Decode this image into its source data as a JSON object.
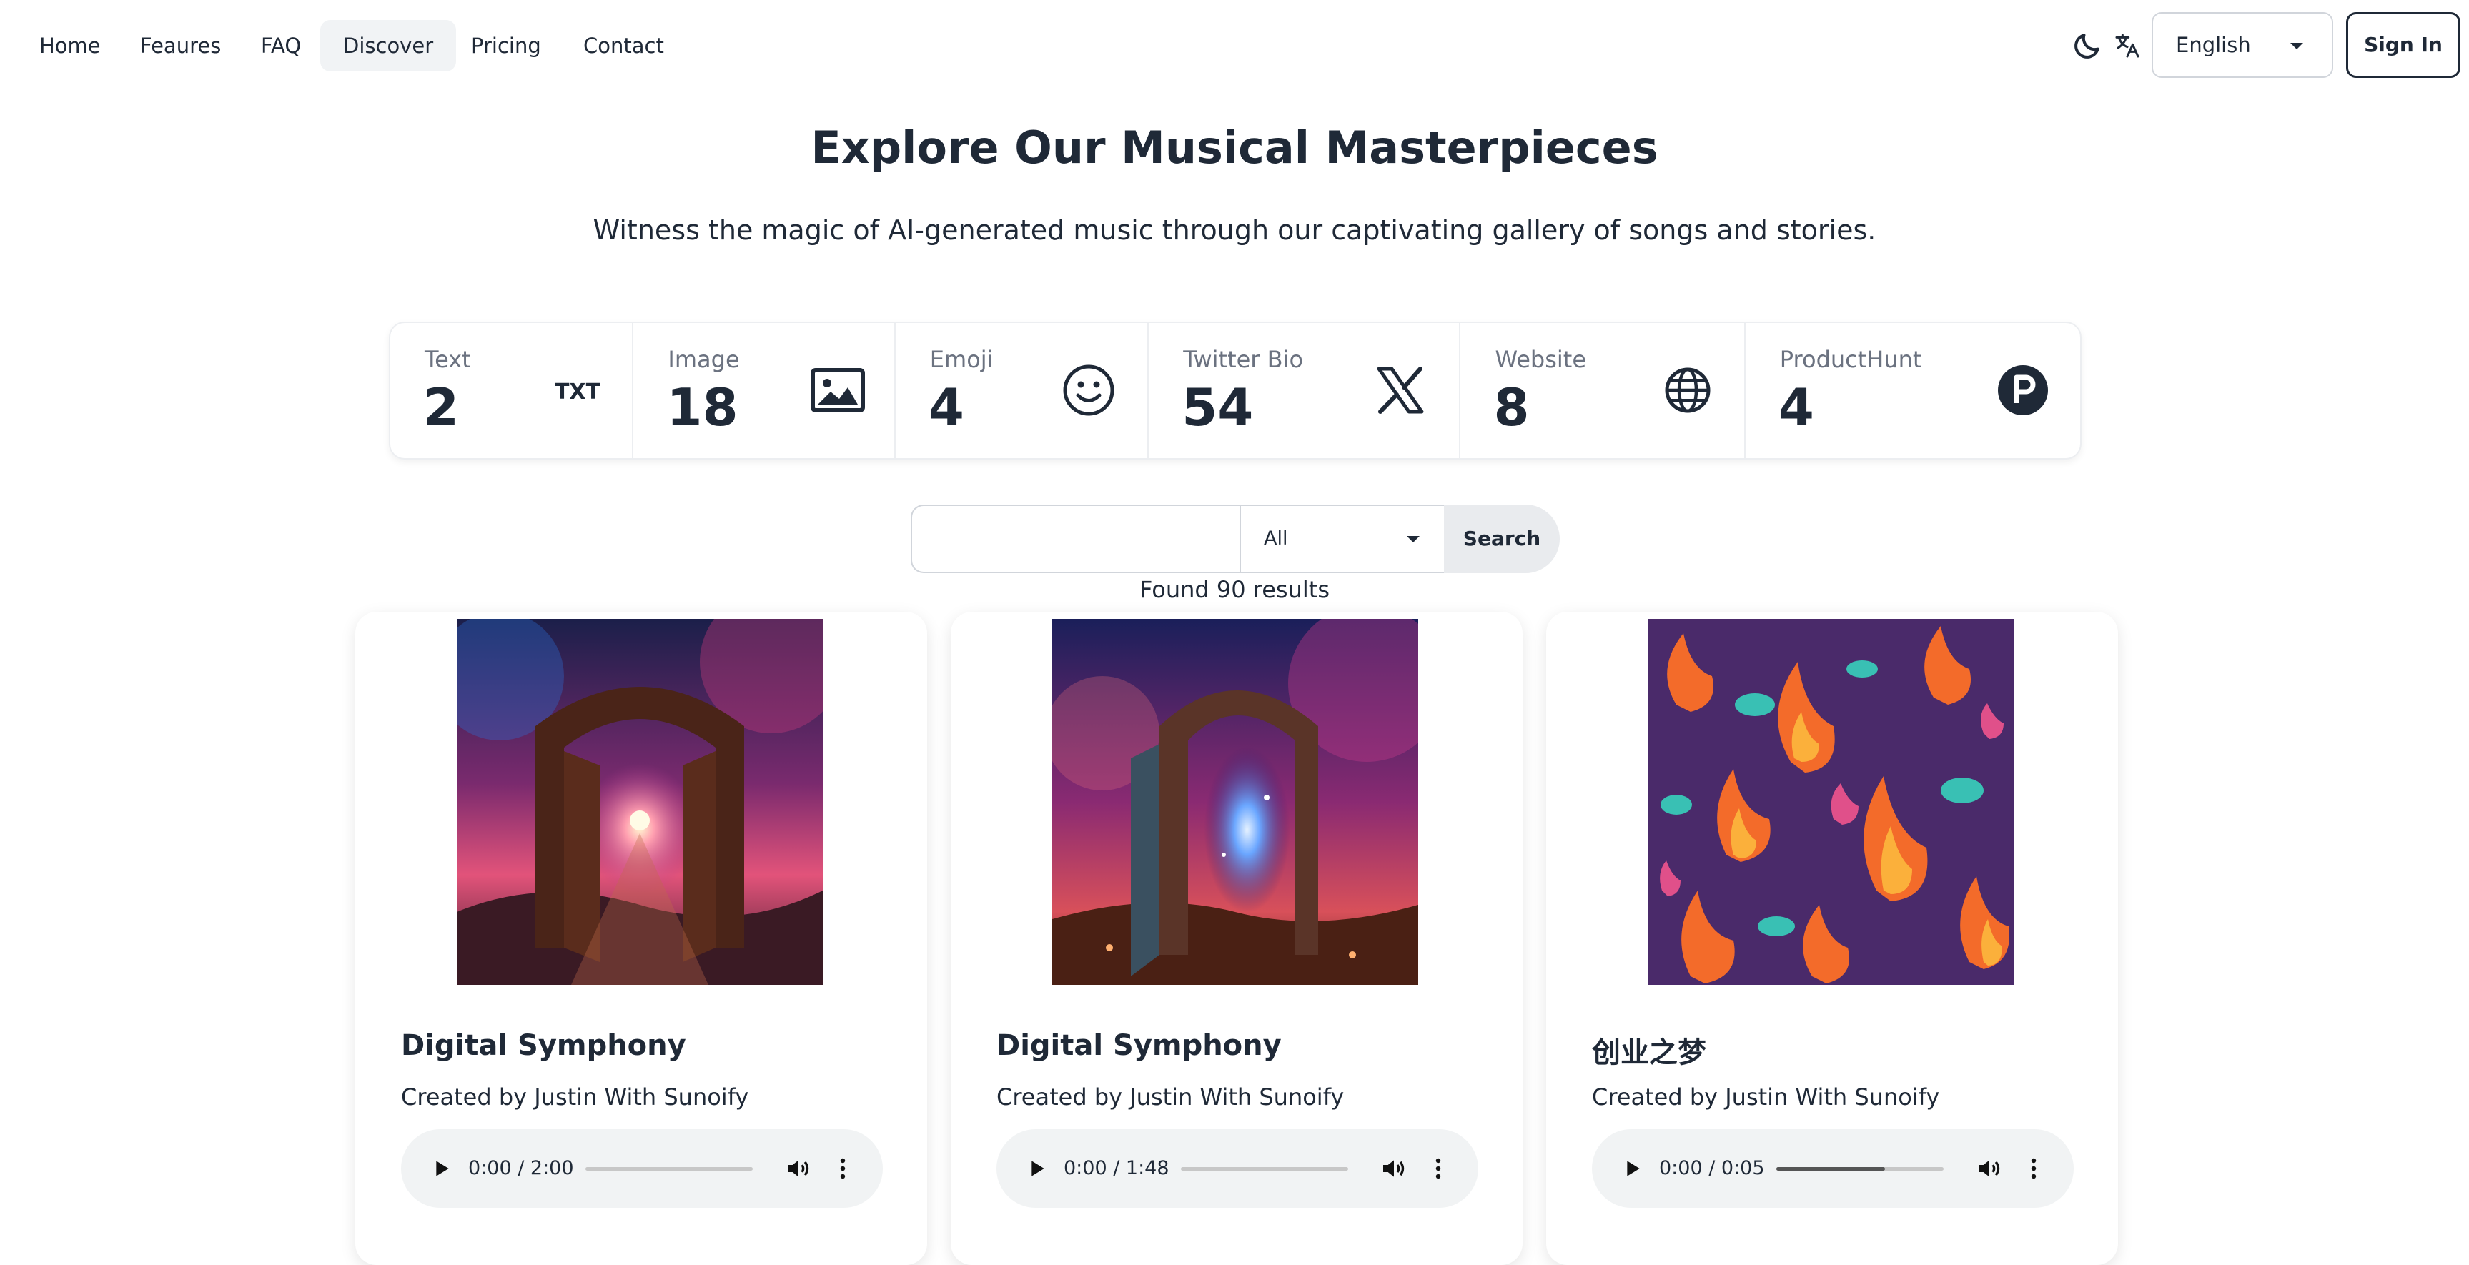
{
  "nav": {
    "items": [
      {
        "label": "Home",
        "active": false
      },
      {
        "label": "Feaures",
        "active": false
      },
      {
        "label": "FAQ",
        "active": false
      },
      {
        "label": "Discover",
        "active": true
      },
      {
        "label": "Pricing",
        "active": false
      },
      {
        "label": "Contact",
        "active": false
      }
    ],
    "theme_icon": "moon-icon",
    "translate_icon": "translate-icon",
    "language": "English",
    "signin_label": "Sign In"
  },
  "hero": {
    "title": "Explore Our Musical Masterpieces",
    "subtitle": "Witness the magic of AI-generated music through our captivating gallery of songs and stories."
  },
  "stats": [
    {
      "label": "Text",
      "value": "2",
      "icon": "txt-icon"
    },
    {
      "label": "Image",
      "value": "18",
      "icon": "image-icon"
    },
    {
      "label": "Emoji",
      "value": "4",
      "icon": "smiley-icon"
    },
    {
      "label": "Twitter Bio",
      "value": "54",
      "icon": "x-logo-icon"
    },
    {
      "label": "Website",
      "value": "8",
      "icon": "globe-icon"
    },
    {
      "label": "ProductHunt",
      "value": "4",
      "icon": "producthunt-icon"
    }
  ],
  "search": {
    "value": "",
    "category": "All",
    "button_label": "Search",
    "results_text": "Found 90 results"
  },
  "songs": [
    {
      "title": "Digital Symphony",
      "creator": "Created by Justin With Sunoify",
      "time": "0:00 / 2:00",
      "progress": 0.0
    },
    {
      "title": "Digital Symphony",
      "creator": "Created by Justin With Sunoify",
      "time": "0:00 / 1:48",
      "progress": 0.0
    },
    {
      "title": "创业之梦",
      "creator": "Created by Justin With Sunoify",
      "time": "0:00 / 0:05",
      "progress": 0.65
    }
  ],
  "colors": {
    "text": "#1f2937",
    "muted": "#6b7280",
    "player_bg": "#f1f3f4",
    "active_nav_bg": "#f1f3f5"
  }
}
